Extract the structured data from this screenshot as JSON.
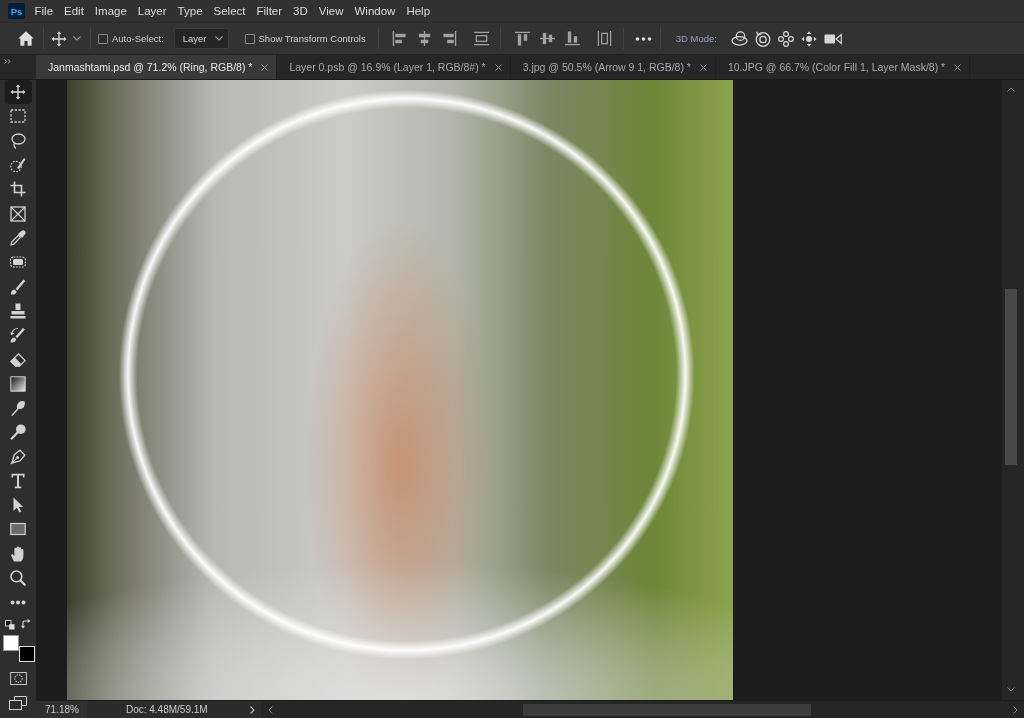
{
  "app": {
    "logo": "Ps"
  },
  "menu": [
    "File",
    "Edit",
    "Image",
    "Layer",
    "Type",
    "Select",
    "Filter",
    "3D",
    "View",
    "Window",
    "Help"
  ],
  "options_bar": {
    "auto_select": {
      "label": "Auto-Select:",
      "checked": false
    },
    "target": {
      "value": "Layer"
    },
    "show_transform_controls": {
      "label": "Show Transform Controls",
      "checked": false
    },
    "mode_label": "3D Mode:"
  },
  "tabs": [
    {
      "label": "Janmashtami.psd @ 71.2% (Ring, RGB/8) *",
      "selected": true
    },
    {
      "label": "Layer 0.psb @ 16.9% (Layer 1, RGB/8#) *",
      "selected": false
    },
    {
      "label": "3.jpg @ 50.5% (Arrow 9 1, RGB/8) *",
      "selected": false
    },
    {
      "label": "10.JPG @ 66.7% (Color Fill 1, Layer Mask/8) *",
      "selected": false
    }
  ],
  "tools": [
    {
      "selected": true
    },
    {
      "selected": false
    },
    {
      "selected": false
    },
    {
      "selected": false
    },
    {
      "selected": false
    },
    {
      "selected": false
    },
    {
      "selected": false
    },
    {
      "selected": false
    },
    {
      "selected": false
    },
    {
      "selected": false
    },
    {
      "selected": false
    },
    {
      "selected": false
    },
    {
      "selected": false
    },
    {
      "selected": false
    },
    {
      "selected": false
    },
    {
      "selected": false
    },
    {
      "selected": false
    },
    {
      "selected": false
    },
    {
      "selected": false
    },
    {
      "selected": false
    },
    {
      "selected": false
    },
    {
      "selected": false
    }
  ],
  "color_swatches": {
    "foreground": {
      "color": "#ffffff"
    },
    "background": {
      "color": "#000000"
    }
  },
  "status_bar": {
    "zoom": "71.18%",
    "doc_info": "Doc: 4.48M/59.1M"
  }
}
